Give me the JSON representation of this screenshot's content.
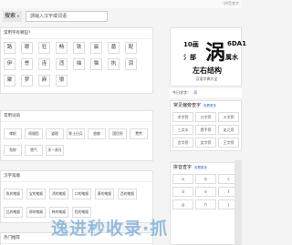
{
  "header": {
    "top_link": "（拼音查字"
  },
  "search": {
    "label": "搜索",
    "caret": "▾",
    "placeholder": "請输入汉字或词语"
  },
  "section1": {
    "title": "常用字有哪些？",
    "cells": [
      "路",
      "眼",
      "狂",
      "畅",
      "铁",
      "晨",
      "墓",
      "配",
      "伊",
      "誉",
      "连",
      "违",
      "抽",
      "猫",
      "执",
      "润",
      "聚",
      "梦",
      "麻",
      "狼"
    ]
  },
  "section2": {
    "title": "常用词语",
    "cells": [
      "律帆",
      "佩服您",
      "道理",
      "陈土仕兵",
      "放佛",
      "国民所",
      "费劳",
      "劲财",
      "肥气",
      "关一贤兄"
    ]
  },
  "section3": {
    "title": "汉字笔顺",
    "cells": [
      "陈的笔顺",
      "宝的笔顺",
      "鸿的笔顺",
      "口的笔顺",
      "黄的笔顺",
      "西的笔顺",
      "比的笔顺",
      "邢的笔顺",
      "韩的笔顺",
      "程的笔顺"
    ]
  },
  "section4": {
    "title": "热门推荐"
  },
  "char_card": {
    "character": "涡",
    "strokes": "10画",
    "code": "6DA1",
    "radical": "氵部",
    "pinyin": "guō",
    "radical_label": "属水",
    "structure": "左右结构",
    "caption": "汉语字典大全"
  },
  "study": {
    "label": "今日学字：",
    "link": "涡"
  },
  "panel_common": {
    "title": "常见偏旁查字",
    "more": "查看更多",
    "cells": [
      "木字旁",
      "口字旁",
      "火字旁",
      "三点水",
      "提手旁",
      "走之旁",
      "言字旁",
      "女字旁",
      "王字旁"
    ]
  },
  "panel_pinyin": {
    "title": "拼音查字",
    "more": "查看更多",
    "cells": [
      "a",
      "b",
      "c",
      "d",
      "e",
      "f",
      "g",
      "h",
      "j"
    ]
  },
  "watermark": "逸进秒收录·抓"
}
